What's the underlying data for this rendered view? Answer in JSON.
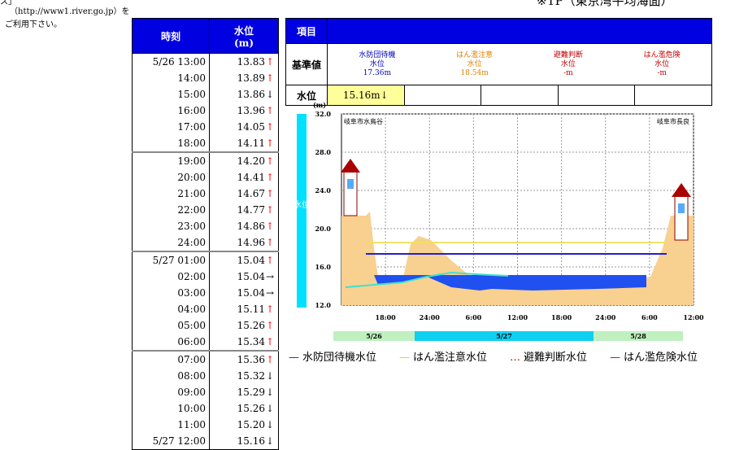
{
  "notes": {
    "top": "ス」",
    "url": "（http://www1.river.go.jp）を",
    "available": "ご利用下さい。",
    "datum": "※TP（東京湾平均海面）"
  },
  "table": {
    "header_time": "時刻",
    "header_level_line1": "水位",
    "header_level_line2": "(m)",
    "rows": [
      {
        "time": "5/26 13:00",
        "level": "13.83",
        "arrow": "↑"
      },
      {
        "time": "14:00",
        "level": "13.89",
        "arrow": "↑"
      },
      {
        "time": "15:00",
        "level": "13.86",
        "arrow": "↓"
      },
      {
        "time": "16:00",
        "level": "13.96",
        "arrow": "↑"
      },
      {
        "time": "17:00",
        "level": "14.05",
        "arrow": "↑"
      },
      {
        "time": "18:00",
        "level": "14.11",
        "arrow": "↑"
      },
      {
        "time": "19:00",
        "level": "14.20",
        "arrow": "↑"
      },
      {
        "time": "20:00",
        "level": "14.41",
        "arrow": "↑"
      },
      {
        "time": "21:00",
        "level": "14.67",
        "arrow": "↑"
      },
      {
        "time": "22:00",
        "level": "14.77",
        "arrow": "↑"
      },
      {
        "time": "23:00",
        "level": "14.86",
        "arrow": "↑"
      },
      {
        "time": "24:00",
        "level": "14.96",
        "arrow": "↑"
      },
      {
        "time": "5/27 01:00",
        "level": "15.04",
        "arrow": "↑"
      },
      {
        "time": "02:00",
        "level": "15.04",
        "arrow": "→"
      },
      {
        "time": "03:00",
        "level": "15.04",
        "arrow": "→"
      },
      {
        "time": "04:00",
        "level": "15.11",
        "arrow": "↑"
      },
      {
        "time": "05:00",
        "level": "15.26",
        "arrow": "↑"
      },
      {
        "time": "06:00",
        "level": "15.34",
        "arrow": "↑"
      },
      {
        "time": "07:00",
        "level": "15.36",
        "arrow": "↑"
      },
      {
        "time": "08:00",
        "level": "15.32",
        "arrow": "↓"
      },
      {
        "time": "09:00",
        "level": "15.29",
        "arrow": "↓"
      },
      {
        "time": "10:00",
        "level": "15.26",
        "arrow": "↓"
      },
      {
        "time": "11:00",
        "level": "15.20",
        "arrow": "↓"
      },
      {
        "time": "5/27 12:00",
        "level": "15.16",
        "arrow": "↓"
      }
    ]
  },
  "info": {
    "item_label": "項目",
    "standard_label": "基準値",
    "standards": [
      {
        "line1": "水防団待機",
        "line2": "水位",
        "value": "17.36m",
        "color": "#0000c0"
      },
      {
        "line1": "はん濫注意",
        "line2": "水位",
        "value": "18.54m",
        "color": "#e08000"
      },
      {
        "line1": "避難判断",
        "line2": "水位",
        "value": "-m",
        "color": "#c00000"
      },
      {
        "line1": "はん濫危険",
        "line2": "水位",
        "value": "-m",
        "color": "#c00000"
      }
    ],
    "level_label": "水位",
    "current_level": "15.16m↓"
  },
  "chart_data": {
    "type": "area",
    "unit": "(m)",
    "y_ticks": [
      "32.0",
      "28.0",
      "24.0",
      "20.0",
      "16.0",
      "12.0"
    ],
    "ylim": [
      12,
      32
    ],
    "left_bank": "岐阜市水鳥谷",
    "right_bank": "岐阜市長良",
    "side_label": "水位",
    "x_ticks": [
      "18:00",
      "24:00",
      "6:00",
      "12:00",
      "18:00",
      "24:00",
      "6:00",
      "12:00"
    ],
    "dates": [
      "5/26",
      "5/27",
      "5/28"
    ],
    "lines": [
      {
        "name": "水防団待機水位",
        "y": 17.36,
        "color": "#2020d0"
      },
      {
        "name": "はん濫注意水位",
        "y": 18.54,
        "color": "#f0e060"
      }
    ],
    "water_surface": 15.16
  },
  "legend": [
    {
      "mark": "—",
      "label": "水防団待機水位",
      "color": "#2020d0"
    },
    {
      "mark": "—",
      "label": "はん濫注意水位",
      "color": "#f0d000"
    },
    {
      "mark": "…",
      "label": "避難判断水位",
      "color": "#e00000"
    },
    {
      "mark": "—",
      "label": "はん濫危険水位",
      "color": "#e00000"
    }
  ]
}
